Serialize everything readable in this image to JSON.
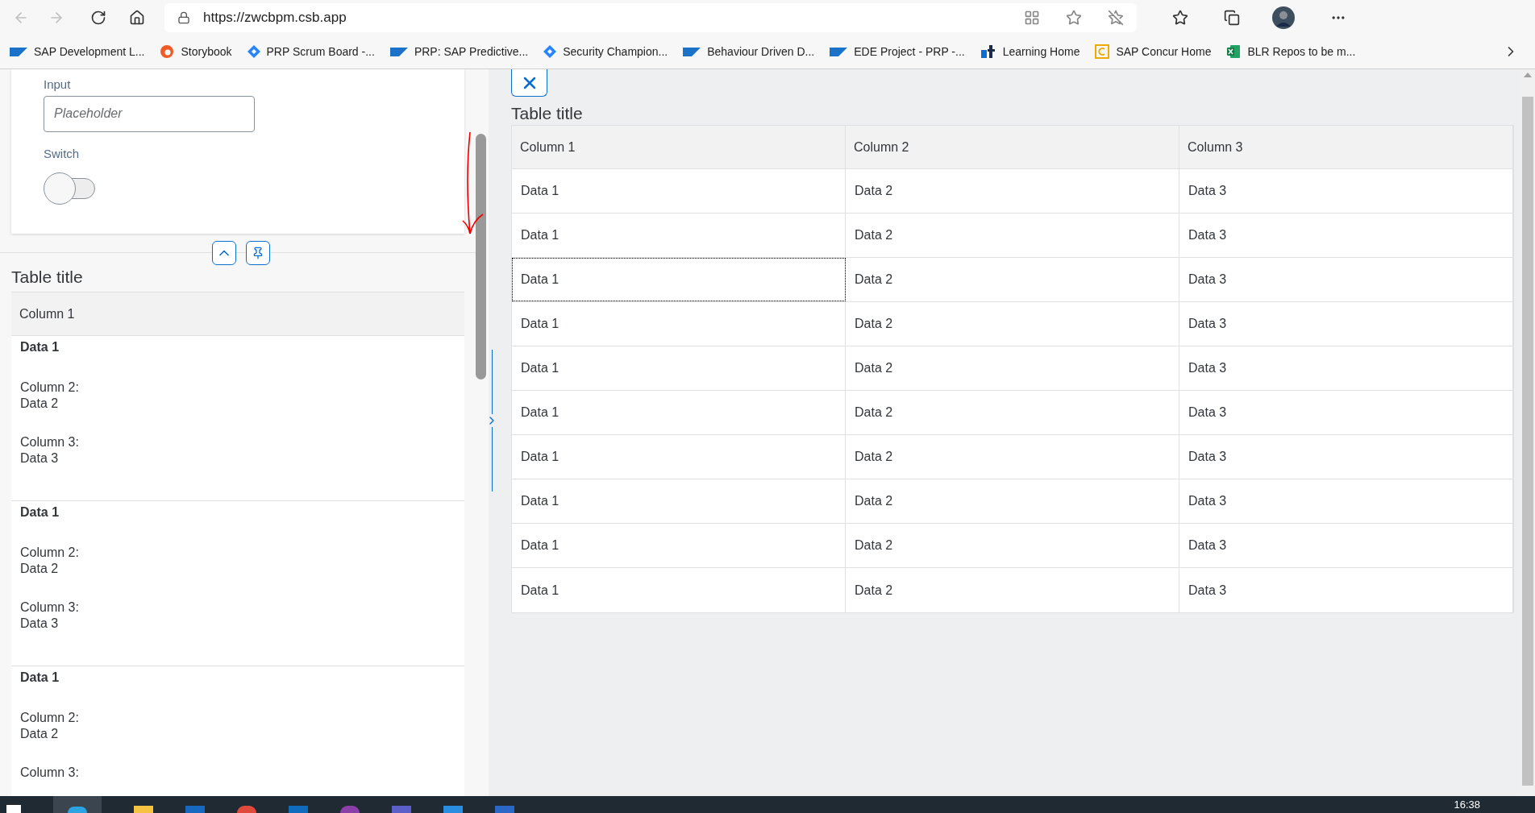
{
  "browser": {
    "url": "https://zwcbpm.csb.app",
    "bookmarks": [
      {
        "label": "SAP Development L...",
        "kind": "sap"
      },
      {
        "label": "Storybook",
        "kind": "flame"
      },
      {
        "label": "PRP Scrum Board -...",
        "kind": "diamond"
      },
      {
        "label": "PRP: SAP Predictive...",
        "kind": "sap"
      },
      {
        "label": "Security Champion...",
        "kind": "diamond"
      },
      {
        "label": "Behaviour Driven D...",
        "kind": "sap"
      },
      {
        "label": "EDE Project - PRP -...",
        "kind": "sap"
      },
      {
        "label": "Learning Home",
        "kind": "sf"
      },
      {
        "label": "SAP Concur Home",
        "kind": "concur"
      },
      {
        "label": "BLR Repos to be m...",
        "kind": "excel"
      }
    ]
  },
  "left_panel": {
    "form": {
      "input": {
        "label": "Input",
        "placeholder": "Placeholder"
      },
      "switch": {
        "label": "Switch",
        "on": false
      }
    },
    "table": {
      "title": "Table title",
      "columns": [
        "Column 1"
      ],
      "rows": [
        {
          "title": "Data 1",
          "details": [
            {
              "label": "Column 2:",
              "value": "Data 2"
            },
            {
              "label": "Column 3:",
              "value": "Data 3"
            }
          ]
        },
        {
          "title": "Data 1",
          "details": [
            {
              "label": "Column 2:",
              "value": "Data 2"
            },
            {
              "label": "Column 3:",
              "value": "Data 3"
            }
          ]
        },
        {
          "title": "Data 1",
          "details": [
            {
              "label": "Column 2:",
              "value": "Data 2"
            },
            {
              "label": "Column 3:"
            }
          ]
        }
      ]
    }
  },
  "right_panel": {
    "table": {
      "title": "Table title",
      "columns": [
        "Column 1",
        "Column 2",
        "Column 3"
      ],
      "rows": [
        {
          "cells": [
            {
              "text": "Data 1",
              "focused": false
            },
            {
              "text": "Data 2",
              "focused": false
            },
            {
              "text": "Data 3",
              "focused": false
            }
          ]
        },
        {
          "cells": [
            {
              "text": "Data 1",
              "focused": false
            },
            {
              "text": "Data 2",
              "focused": false
            },
            {
              "text": "Data 3",
              "focused": false
            }
          ]
        },
        {
          "cells": [
            {
              "text": "Data 1",
              "focused": true
            },
            {
              "text": "Data 2",
              "focused": false
            },
            {
              "text": "Data 3",
              "focused": false
            }
          ]
        },
        {
          "cells": [
            {
              "text": "Data 1",
              "focused": false
            },
            {
              "text": "Data 2",
              "focused": false
            },
            {
              "text": "Data 3",
              "focused": false
            }
          ]
        },
        {
          "cells": [
            {
              "text": "Data 1",
              "focused": false
            },
            {
              "text": "Data 2",
              "focused": false
            },
            {
              "text": "Data 3",
              "focused": false
            }
          ]
        },
        {
          "cells": [
            {
              "text": "Data 1",
              "focused": false
            },
            {
              "text": "Data 2",
              "focused": false
            },
            {
              "text": "Data 3",
              "focused": false
            }
          ]
        },
        {
          "cells": [
            {
              "text": "Data 1",
              "focused": false
            },
            {
              "text": "Data 2",
              "focused": false
            },
            {
              "text": "Data 3",
              "focused": false
            }
          ]
        },
        {
          "cells": [
            {
              "text": "Data 1",
              "focused": false
            },
            {
              "text": "Data 2",
              "focused": false
            },
            {
              "text": "Data 3",
              "focused": false
            }
          ]
        },
        {
          "cells": [
            {
              "text": "Data 1",
              "focused": false
            },
            {
              "text": "Data 2",
              "focused": false
            },
            {
              "text": "Data 3",
              "focused": false
            }
          ]
        },
        {
          "cells": [
            {
              "text": "Data 1",
              "focused": false
            },
            {
              "text": "Data 2",
              "focused": false
            },
            {
              "text": "Data 3",
              "focused": false
            }
          ]
        }
      ]
    }
  },
  "taskbar": {
    "clock": "16:38"
  }
}
